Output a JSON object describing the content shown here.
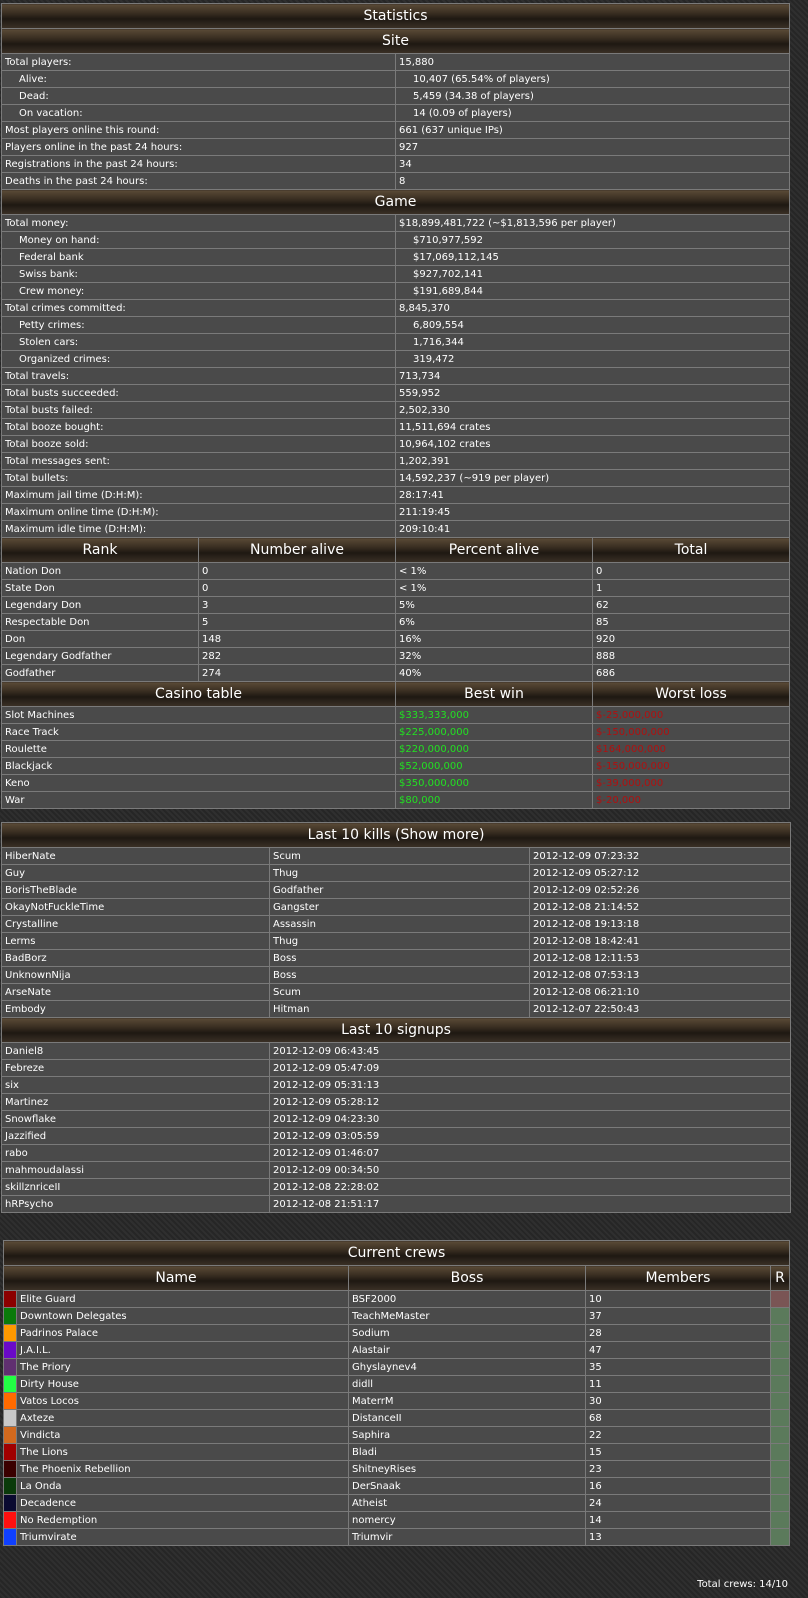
{
  "statistics": {
    "title": "Statistics",
    "site_title": "Site",
    "site": [
      {
        "label": "Total players:",
        "value": "15,880",
        "indent": false
      },
      {
        "label": "Alive:",
        "value": "10,407 (65.54% of players)",
        "indent": true
      },
      {
        "label": "Dead:",
        "value": "5,459 (34.38 of players)",
        "indent": true
      },
      {
        "label": "On vacation:",
        "value": "14 (0.09 of players)",
        "indent": true
      },
      {
        "label": "Most players online this round:",
        "value": "661 (637 unique IPs)",
        "indent": false
      },
      {
        "label": "Players online in the past 24 hours:",
        "value": "927",
        "indent": false
      },
      {
        "label": "Registrations in the past 24 hours:",
        "value": "34",
        "indent": false
      },
      {
        "label": "Deaths in the past 24 hours:",
        "value": "8",
        "indent": false
      }
    ],
    "game_title": "Game",
    "game": [
      {
        "label": "Total money:",
        "value": "$18,899,481,722 (~$1,813,596 per player)",
        "indent": false
      },
      {
        "label": "Money on hand:",
        "value": "$710,977,592",
        "indent": true
      },
      {
        "label": "Federal bank",
        "value": "$17,069,112,145",
        "indent": true
      },
      {
        "label": "Swiss bank:",
        "value": "$927,702,141",
        "indent": true
      },
      {
        "label": "Crew money:",
        "value": "$191,689,844",
        "indent": true
      },
      {
        "label": "Total crimes committed:",
        "value": "8,845,370",
        "indent": false
      },
      {
        "label": "Petty crimes:",
        "value": "6,809,554",
        "indent": true
      },
      {
        "label": "Stolen cars:",
        "value": "1,716,344",
        "indent": true
      },
      {
        "label": "Organized crimes:",
        "value": "319,472",
        "indent": true
      },
      {
        "label": "Total travels:",
        "value": "713,734",
        "indent": false
      },
      {
        "label": "Total busts succeeded:",
        "value": "559,952",
        "indent": false
      },
      {
        "label": "Total busts failed:",
        "value": "2,502,330",
        "indent": false
      },
      {
        "label": "Total booze bought:",
        "value": "11,511,694 crates",
        "indent": false
      },
      {
        "label": "Total booze sold:",
        "value": "10,964,102 crates",
        "indent": false
      },
      {
        "label": "Total messages sent:",
        "value": "1,202,391",
        "indent": false
      },
      {
        "label": "Total bullets:",
        "value": "14,592,237 (~919 per player)",
        "indent": false
      },
      {
        "label": "Maximum jail time (D:H:M):",
        "value": "28:17:41",
        "indent": false
      },
      {
        "label": "Maximum online time (D:H:M):",
        "value": "211:19:45",
        "indent": false
      },
      {
        "label": "Maximum idle time (D:H:M):",
        "value": "209:10:41",
        "indent": false
      }
    ],
    "rank_headers": [
      "Rank",
      "Number alive",
      "Percent alive",
      "Total"
    ],
    "ranks": [
      [
        "Nation Don",
        "0",
        "< 1%",
        "0"
      ],
      [
        "State Don",
        "0",
        "< 1%",
        "1"
      ],
      [
        "Legendary Don",
        "3",
        "5%",
        "62"
      ],
      [
        "Respectable Don",
        "5",
        "6%",
        "85"
      ],
      [
        "Don",
        "148",
        "16%",
        "920"
      ],
      [
        "Legendary Godfather",
        "282",
        "32%",
        "888"
      ],
      [
        "Godfather",
        "274",
        "40%",
        "686"
      ]
    ],
    "casino_headers": [
      "Casino table",
      "Best win",
      "Worst loss"
    ],
    "casino": [
      [
        "Slot Machines",
        "$333,333,000",
        "$-25,000,000"
      ],
      [
        "Race Track",
        "$225,000,000",
        "$-150,000,000"
      ],
      [
        "Roulette",
        "$220,000,000",
        "$164,000,000"
      ],
      [
        "Blackjack",
        "$52,000,000",
        "$-150,000,000"
      ],
      [
        "Keno",
        "$350,000,000",
        "$-39,000,000"
      ],
      [
        "War",
        "$80,000",
        "$-20,000"
      ]
    ]
  },
  "kills": {
    "title": "Last 10 kills (Show more)",
    "rows": [
      [
        "HiberNate",
        "Scum",
        "2012-12-09 07:23:32"
      ],
      [
        "Guy",
        "Thug",
        "2012-12-09 05:27:12"
      ],
      [
        "BorisTheBlade",
        "Godfather",
        "2012-12-09 02:52:26"
      ],
      [
        "OkayNotFuckleTime",
        "Gangster",
        "2012-12-08 21:14:52"
      ],
      [
        "Crystalline",
        "Assassin",
        "2012-12-08 19:13:18"
      ],
      [
        "Lerms",
        "Thug",
        "2012-12-08 18:42:41"
      ],
      [
        "BadBorz",
        "Boss",
        "2012-12-08 12:11:53"
      ],
      [
        "UnknownNija",
        "Boss",
        "2012-12-08 07:53:13"
      ],
      [
        "ArseNate",
        "Scum",
        "2012-12-08 06:21:10"
      ],
      [
        "Embody",
        "Hitman",
        "2012-12-07 22:50:43"
      ]
    ]
  },
  "signups": {
    "title": "Last 10 signups",
    "rows": [
      [
        "Daniel8",
        "2012-12-09 06:43:45"
      ],
      [
        "Febreze",
        "2012-12-09 05:47:09"
      ],
      [
        "six",
        "2012-12-09 05:31:13"
      ],
      [
        "Martinez",
        "2012-12-09 05:28:12"
      ],
      [
        "Snowflake",
        "2012-12-09 04:23:30"
      ],
      [
        "Jazzified",
        "2012-12-09 03:05:59"
      ],
      [
        "rabo",
        "2012-12-09 01:46:07"
      ],
      [
        "mahmoudalassi",
        "2012-12-09 00:34:50"
      ],
      [
        "skillznriceII",
        "2012-12-08 22:28:02"
      ],
      [
        "hRPsycho",
        "2012-12-08 21:51:17"
      ]
    ]
  },
  "crews": {
    "title": "Current crews",
    "headers": [
      "Name",
      "Boss",
      "Members",
      "R"
    ],
    "rows": [
      {
        "color": "#8b0000",
        "name": "Elite Guard",
        "boss": "BSF2000",
        "members": "10",
        "flag": "#7a5555"
      },
      {
        "color": "#0a7a0a",
        "name": "Downtown Delegates",
        "boss": "TeachMeMaster",
        "members": "37",
        "flag": "#5b7a5b"
      },
      {
        "color": "#ff9900",
        "name": "Padrinos Palace",
        "boss": "Sodium",
        "members": "28",
        "flag": "#5b7a5b"
      },
      {
        "color": "#6a0ac8",
        "name": "J.A.I.L.",
        "boss": "Alastair",
        "members": "47",
        "flag": "#5b7a5b"
      },
      {
        "color": "#603070",
        "name": "The Priory",
        "boss": "Ghyslaynev4",
        "members": "35",
        "flag": "#5b7a5b"
      },
      {
        "color": "#22ff44",
        "name": "Dirty House",
        "boss": "didll",
        "members": "11",
        "flag": "#5b7a5b"
      },
      {
        "color": "#ff6a00",
        "name": "Vatos Locos",
        "boss": "MaterrM",
        "members": "30",
        "flag": "#5b7a5b"
      },
      {
        "color": "#c8c8c8",
        "name": "Axteze",
        "boss": "DistanceII",
        "members": "68",
        "flag": "#5b7a5b"
      },
      {
        "color": "#d2691e",
        "name": "Vindicta",
        "boss": "Saphira",
        "members": "22",
        "flag": "#5b7a5b"
      },
      {
        "color": "#a00000",
        "name": "The Lions",
        "boss": "Bladi",
        "members": "15",
        "flag": "#5b7a5b"
      },
      {
        "color": "#3a0000",
        "name": "The Phoenix Rebellion",
        "boss": "ShitneyRises",
        "members": "23",
        "flag": "#5b7a5b"
      },
      {
        "color": "#0a3a0a",
        "name": "La Onda",
        "boss": "DerSnaak",
        "members": "16",
        "flag": "#5b7a5b"
      },
      {
        "color": "#0a0a30",
        "name": "Decadence",
        "boss": "Atheist",
        "members": "24",
        "flag": "#5b7a5b"
      },
      {
        "color": "#ff1010",
        "name": "No Redemption",
        "boss": "nomercy",
        "members": "14",
        "flag": "#5b7a5b"
      },
      {
        "color": "#1040ff",
        "name": "Triumvirate",
        "boss": "Triumvir",
        "members": "13",
        "flag": "#5b7a5b"
      }
    ],
    "total": "Total crews: 14/10"
  }
}
